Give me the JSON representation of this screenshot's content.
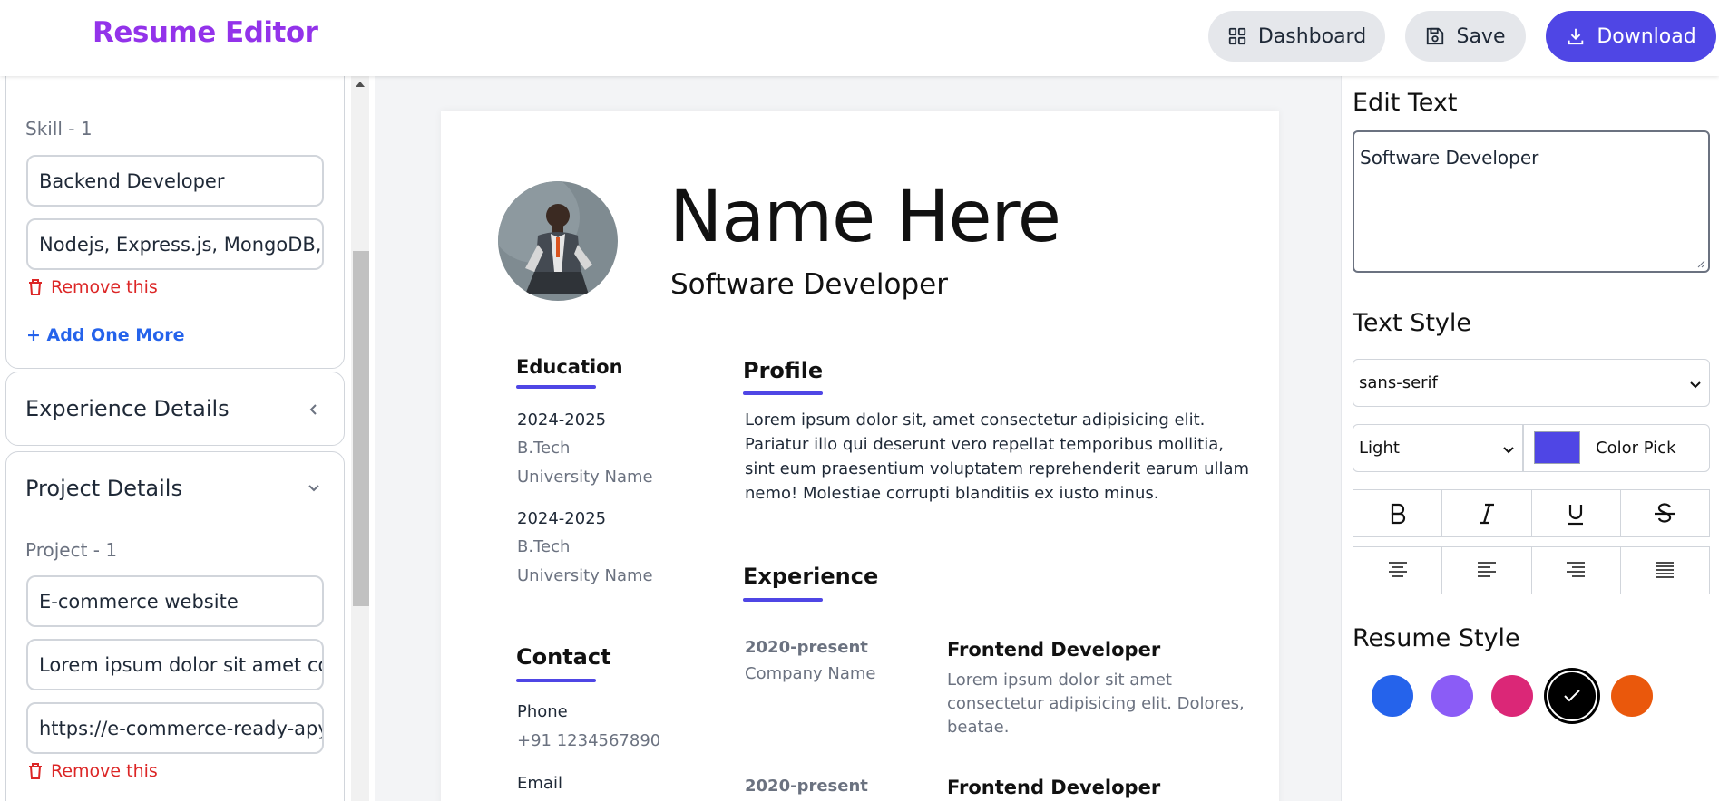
{
  "header": {
    "title": "Resume Editor",
    "dashboard_label": "Dashboard",
    "save_label": "Save",
    "download_label": "Download"
  },
  "left": {
    "skill": {
      "label": "Skill - 1",
      "title_value": "Backend Developer",
      "tools_value": "Nodejs, Express.js, MongoDB, A",
      "remove_label": "Remove this",
      "add_label": "+ Add One More"
    },
    "experience_section": "Experience Details",
    "project_section": "Project Details",
    "project": {
      "label": "Project - 1",
      "name_value": "E-commerce website",
      "desc_value": "Lorem ipsum dolor sit amet cor",
      "url_value": "https://e-commerce-ready-apy.",
      "remove_label": "Remove this"
    }
  },
  "resume": {
    "name": "Name Here",
    "role": "Software Developer",
    "education_heading": "Education",
    "education": [
      {
        "years": "2024-2025",
        "degree": "B.Tech",
        "school": "University Name"
      },
      {
        "years": "2024-2025",
        "degree": "B.Tech",
        "school": "University Name"
      }
    ],
    "contact_heading": "Contact",
    "phone_label": "Phone",
    "phone_value": "+91 1234567890",
    "email_label": "Email",
    "profile_heading": "Profile",
    "profile_lines": [
      "Lorem ipsum dolor sit, amet consectetur adipisicing elit.",
      "Pariatur illo qui deserunt vero repellat temporibus mollitia,",
      "sint eum praesentium voluptatem reprehenderit earum ullam",
      "nemo! Molestiae corrupti blanditiis ex iusto minus."
    ],
    "experience_heading": "Experience",
    "experience": [
      {
        "date": "2020-present",
        "company": "Company Name",
        "title": "Frontend Developer",
        "desc_lines": [
          "Lorem ipsum dolor sit amet",
          "consectetur adipisicing elit. Dolores,",
          "beatae."
        ]
      },
      {
        "date": "2020-present",
        "title": "Frontend Developer"
      }
    ]
  },
  "right": {
    "edit_text_title": "Edit Text",
    "edit_text_value": "Software Developer",
    "text_style_title": "Text Style",
    "font_value": "sans-serif",
    "weight_value": "Light",
    "color_pick_label": "Color Pick",
    "resume_style_title": "Resume Style",
    "selected_color": "#4f46e5",
    "style_colors": [
      "#2563eb",
      "#8b5cf6",
      "#db2777",
      "#000000",
      "#ea580c"
    ]
  },
  "icons": [
    "dashboard-icon",
    "save-icon",
    "download-icon",
    "trash-icon",
    "chevron-left-icon",
    "chevron-down-icon",
    "bold-icon",
    "italic-icon",
    "underline-icon",
    "strikethrough-icon",
    "align-center-icon",
    "align-left-icon",
    "align-right-icon",
    "align-justify-icon",
    "check-icon"
  ]
}
